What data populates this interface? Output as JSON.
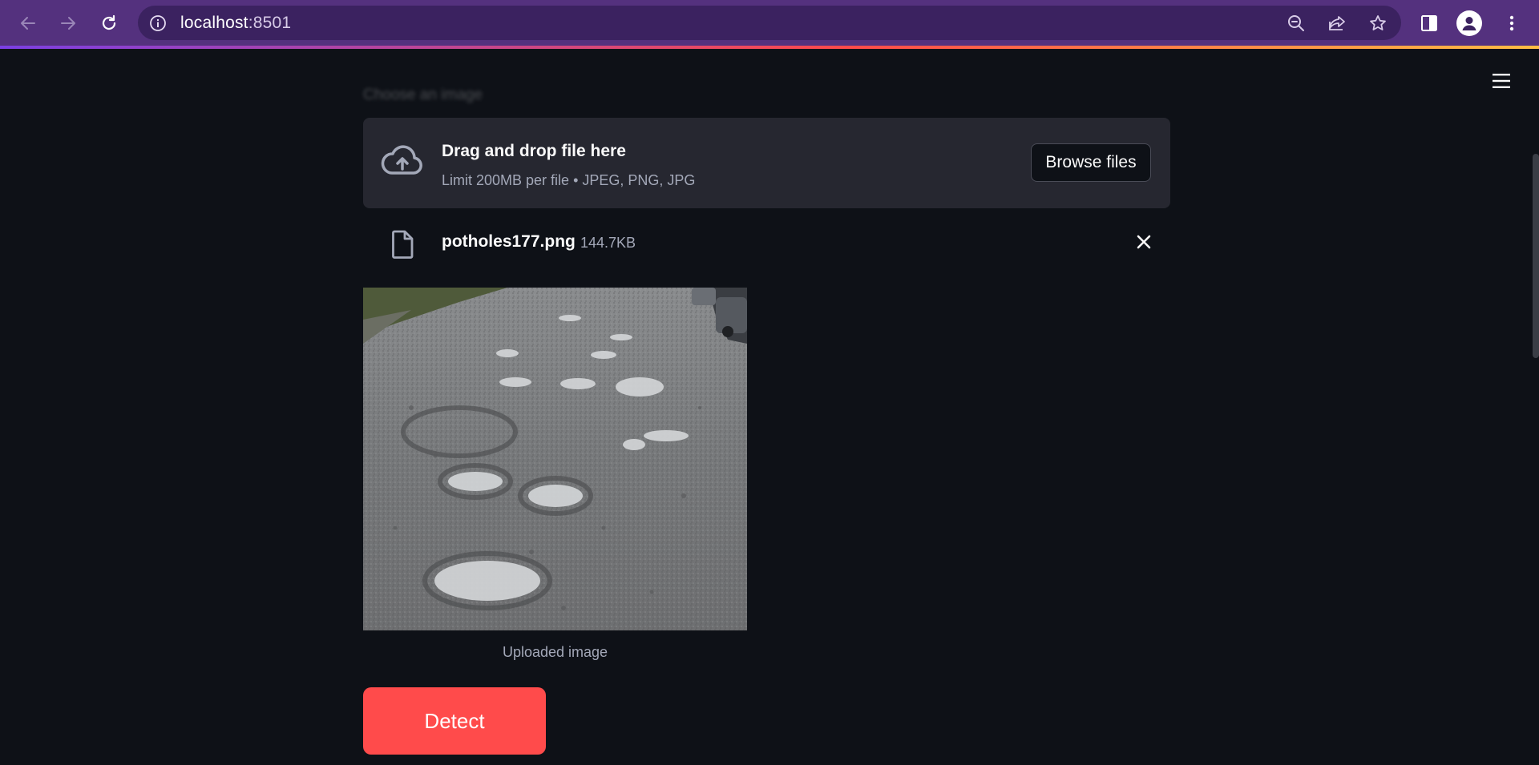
{
  "browser": {
    "url_host": "localhost",
    "url_port": ":8501"
  },
  "uploader": {
    "label": "Choose an image",
    "dropzone_title": "Drag and drop file here",
    "dropzone_limit": "Limit 200MB per file • JPEG, PNG, JPG",
    "browse_label": "Browse files"
  },
  "file": {
    "name": "potholes177.png",
    "size": "144.7KB"
  },
  "image": {
    "caption": "Uploaded image"
  },
  "actions": {
    "detect_label": "Detect"
  },
  "colors": {
    "app_background": "#0e1117",
    "dropzone_background": "#262730",
    "primary": "#ff4b4b",
    "browser_frame": "#54317e"
  },
  "icons": [
    "back-arrow-icon",
    "forward-arrow-icon",
    "reload-icon",
    "info-icon",
    "zoom-icon",
    "share-icon",
    "star-icon",
    "side-panel-icon",
    "profile-icon",
    "kebab-menu-icon",
    "hamburger-menu-icon",
    "cloud-upload-icon",
    "file-icon",
    "close-icon"
  ]
}
